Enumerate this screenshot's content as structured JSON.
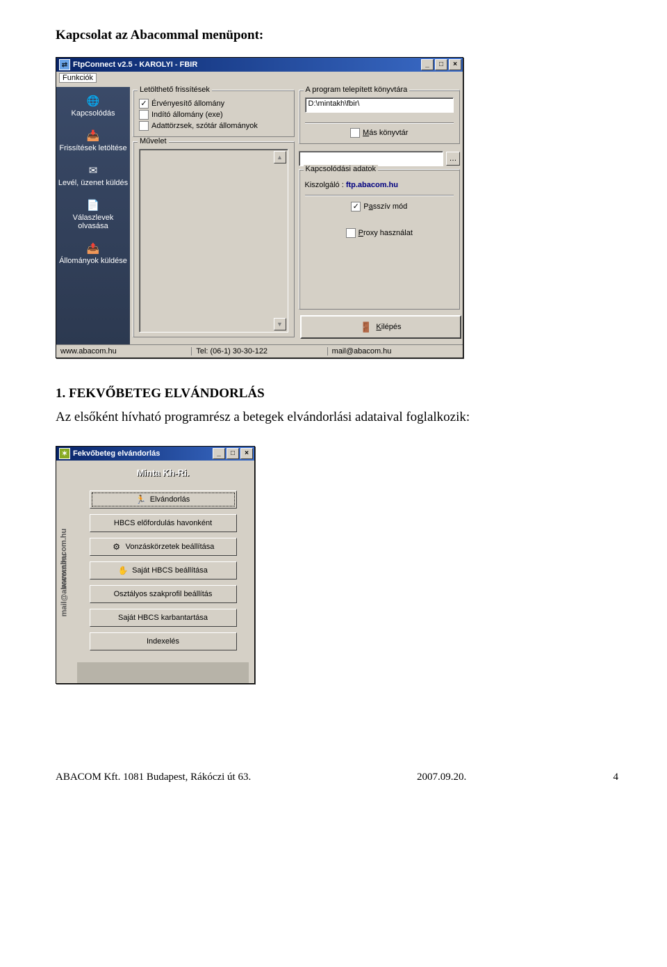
{
  "doc": {
    "heading1": "Kapcsolat az Abacommal menüpont:",
    "heading2": "1. FEKVŐBETEG ELVÁNDORLÁS",
    "paragraph": "Az elsőként hívható programrész a betegek elvándorlási adataival foglalkozik:"
  },
  "footer": {
    "left": "ABACOM Kft. 1081 Budapest, Rákóczi út 63.",
    "center": "2007.09.20.",
    "right": "4"
  },
  "win1": {
    "title": "FtpConnect v2.5 - KAROLYI - FBIR",
    "menu": "Funkciók",
    "sidebar": [
      {
        "label": "Kapcsolódás",
        "icon": "🌐"
      },
      {
        "label": "Frissítések letöltése",
        "icon": "📥"
      },
      {
        "label": "Levél, üzenet küldés",
        "icon": "✉"
      },
      {
        "label": "Válaszlevek olvasása",
        "icon": "📄"
      },
      {
        "label": "Állományok küldése",
        "icon": "📤"
      }
    ],
    "group_updates": {
      "title": "Letölthető frissítések",
      "items": [
        {
          "checked": true,
          "label": "Érvényesítő állomány"
        },
        {
          "checked": false,
          "label": "Indító állomány (exe)"
        },
        {
          "checked": false,
          "label": "Adattörzsek, szótár állományok"
        }
      ]
    },
    "group_dir": {
      "title": "A program telepített könyvtára",
      "path": "D:\\mintakh\\fbir\\",
      "other_dir": "Más könyvtár"
    },
    "group_op": {
      "title": "Művelet"
    },
    "group_conn": {
      "title": "Kapcsolódási adatok",
      "server_label": "Kiszolgáló :",
      "server_value": "ftp.abacom.hu",
      "passive": "Passzív mód",
      "proxy": "Proxy használat"
    },
    "exit": "Kilépés",
    "status": {
      "url": "www.abacom.hu",
      "tel": "Tel: (06-1) 30-30-122",
      "mail": "mail@abacom.hu"
    }
  },
  "win2": {
    "title": "Fekvőbeteg elvándorlás",
    "vert1": "www.abacom.hu",
    "vert2": "mail@abacom.hu",
    "main_title": "Minta Kh-Ri.",
    "buttons": [
      {
        "label": "Elvándorlás",
        "icon": "🏃",
        "focused": true
      },
      {
        "label": "HBCS előfordulás havonként",
        "icon": "",
        "focused": false
      },
      {
        "label": "Vonzáskörzetek beállítása",
        "icon": "⚙",
        "focused": false
      },
      {
        "label": "Saját HBCS beállítása",
        "icon": "✋",
        "focused": false
      },
      {
        "label": "Osztályos szakprofil beállítás",
        "icon": "",
        "focused": false
      },
      {
        "label": "Saját HBCS karbantartása",
        "icon": "",
        "focused": false
      },
      {
        "label": "Indexelés",
        "icon": "",
        "focused": false
      }
    ]
  }
}
